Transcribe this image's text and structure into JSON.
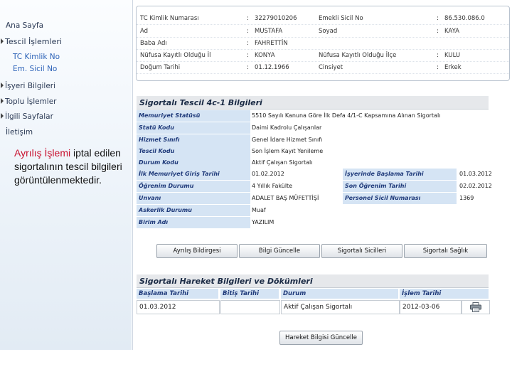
{
  "sidebar": {
    "items": [
      {
        "label": "Ana Sayfa"
      },
      {
        "label": "Tescil İşlemleri"
      },
      {
        "label": "TC Kimlik No"
      },
      {
        "label": "Em. Sicil No"
      },
      {
        "label": "İşyeri Bilgileri"
      },
      {
        "label": "Toplu İşlemler"
      },
      {
        "label": "İlgili Sayfalar"
      },
      {
        "label": "İletişim"
      }
    ],
    "caption_highlight": "Ayrılış İşlemi",
    "caption_rest": " iptal edilen sigortalının tescil bilgileri görüntülenmektedir."
  },
  "info": {
    "rows": [
      {
        "l1": "TC Kimlik Numarası",
        "v1": "32279010206",
        "l2": "Emekli Sicil No",
        "v2": "86.530.086.0"
      },
      {
        "l1": "Ad",
        "v1": "MUSTAFA",
        "l2": "Soyad",
        "v2": "KAYA"
      },
      {
        "l1": "Baba Adı",
        "v1": "FAHRETTİN",
        "l2": "",
        "v2": ""
      },
      {
        "l1": "Nüfusa Kayıtlı Olduğu İl",
        "v1": "KONYA",
        "l2": "Nüfusa Kayıtlı Olduğu İlçe",
        "v2": "KULU"
      },
      {
        "l1": "Doğum Tarihi",
        "v1": "01.12.1966",
        "l2": "Cinsiyet",
        "v2": "Erkek"
      }
    ]
  },
  "tescil": {
    "title": "Sigortalı Tescil 4c-1 Bilgileri",
    "rows": [
      {
        "label": "Memuriyet Statüsü",
        "value": "5510 Sayılı Kanuna Göre İlk Defa 4/1-C Kapsamına Alınan Sigortalı"
      },
      {
        "label": "Statü Kodu",
        "value": "Daimi Kadrolu Çalışanlar"
      },
      {
        "label": "Hizmet Sınıfı",
        "value": "Genel İdare Hizmet Sınıfı"
      },
      {
        "label": "Tescil Kodu",
        "value": "Son İşlem Kayıt Yenileme"
      },
      {
        "label": "Durum Kodu",
        "value": "Aktif Çalışan Sigortalı"
      },
      {
        "label": "İlk Memuriyet Giriş Tarihi",
        "value": "01.02.2012",
        "label2": "İşyerinde Başlama Tarihi",
        "value2": "01.03.2012"
      },
      {
        "label": "Öğrenim Durumu",
        "value": "4 Yıllık Fakülte",
        "label2": "Son Öğrenim Tarihi",
        "value2": "02.02.2012"
      },
      {
        "label": "Unvanı",
        "value": "ADALET BAŞ MÜFETTİŞİ",
        "label2": "Personel Sicil Numarası",
        "value2": "1369"
      },
      {
        "label": "Askerlik Durumu",
        "value": "Muaf"
      },
      {
        "label": "Birim Adı",
        "value": "YAZILIM"
      }
    ]
  },
  "buttons": {
    "ayrilis": "Ayrılış Bildirgesi",
    "bilgi": "Bilgi Güncelle",
    "sicilleri": "Sigortalı Sicilleri",
    "saglik": "Sigortalı Sağlık"
  },
  "hareket": {
    "title": "Sigortalı Hareket Bilgileri ve Dökümleri",
    "columns": [
      "Başlama Tarihi",
      "Bitiş Tarihi",
      "Durum",
      "İşlem Tarihi"
    ],
    "row": {
      "baslama": "01.03.2012",
      "bitis": "",
      "durum": "Aktif Çalışan Sigortalı",
      "islem": "2012-03-06"
    },
    "update_button": "Hareket Bilgisi Güncelle"
  },
  "icons": {
    "print": "printer-icon",
    "arrow": "triangle-right-icon"
  }
}
